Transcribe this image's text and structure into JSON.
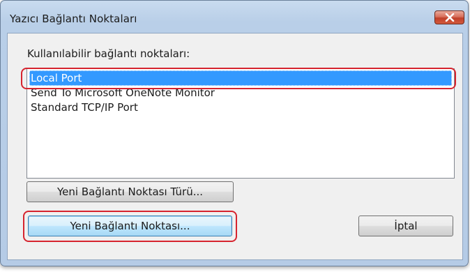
{
  "window": {
    "title": "Yazıcı Bağlantı Noktaları"
  },
  "list": {
    "label": "Kullanılabilir bağlantı noktaları:",
    "items": [
      "Local Port",
      "Send To Microsoft OneNote Monitor",
      "Standard TCP/IP Port"
    ],
    "selected_index": 0
  },
  "buttons": {
    "new_port_type": "Yeni Bağlantı Noktası Türü...",
    "new_port": "Yeni Bağlantı Noktası...",
    "cancel": "İptal"
  },
  "colors": {
    "selection": "#3399ff",
    "highlight_annotation": "#d6242f",
    "close_button": "#c94a34"
  },
  "icons": {
    "close": "close-icon"
  }
}
